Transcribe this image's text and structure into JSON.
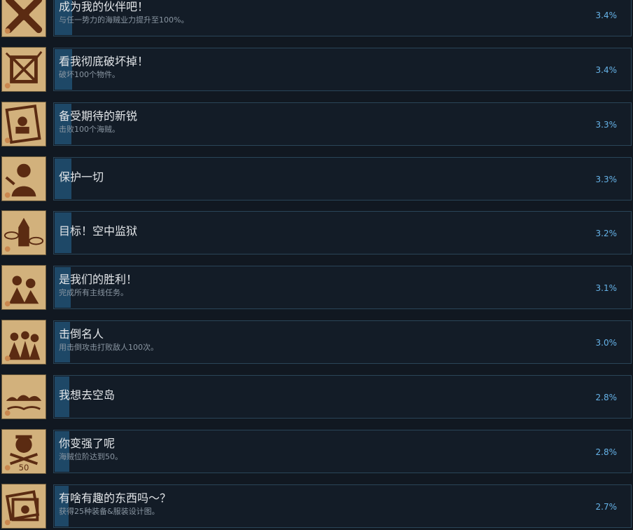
{
  "achievements": [
    {
      "title": "成为我的伙伴吧！",
      "desc": "与任一势力的海贼业力提升至100%。",
      "percent": "3.4%",
      "fill": 3.4,
      "icon": "crossed-arms-icon"
    },
    {
      "title": "看我彻底破坏掉！",
      "desc": "破坏100个物件。",
      "percent": "3.4%",
      "fill": 3.4,
      "icon": "smashed-crate-icon"
    },
    {
      "title": "备受期待的新锐",
      "desc": "击败100个海贼。",
      "percent": "3.3%",
      "fill": 3.3,
      "icon": "wanted-poster-icon"
    },
    {
      "title": "保护一切",
      "desc": "",
      "percent": "3.3%",
      "fill": 3.3,
      "icon": "guardian-silhouette-icon"
    },
    {
      "title": "目标！空中监狱",
      "desc": "",
      "percent": "3.2%",
      "fill": 3.2,
      "icon": "sky-prison-icon"
    },
    {
      "title": "是我们的胜利！",
      "desc": "完成所有主线任务。",
      "percent": "3.1%",
      "fill": 3.1,
      "icon": "victory-crew-icon"
    },
    {
      "title": "击倒名人",
      "desc": "用击倒攻击打败敌人100次。",
      "percent": "3.0%",
      "fill": 3.0,
      "icon": "knockdown-crowd-icon"
    },
    {
      "title": "我想去空岛",
      "desc": "",
      "percent": "2.8%",
      "fill": 2.8,
      "icon": "cloud-island-icon"
    },
    {
      "title": "你变强了呢",
      "desc": "海贼位阶达到50。",
      "percent": "2.8%",
      "fill": 2.8,
      "icon": "skull-fifty-icon"
    },
    {
      "title": "有啥有趣的东西吗～？",
      "desc": "获得25种装备&服装设计图。",
      "percent": "2.7%",
      "fill": 2.7,
      "icon": "blueprint-scroll-icon"
    }
  ]
}
